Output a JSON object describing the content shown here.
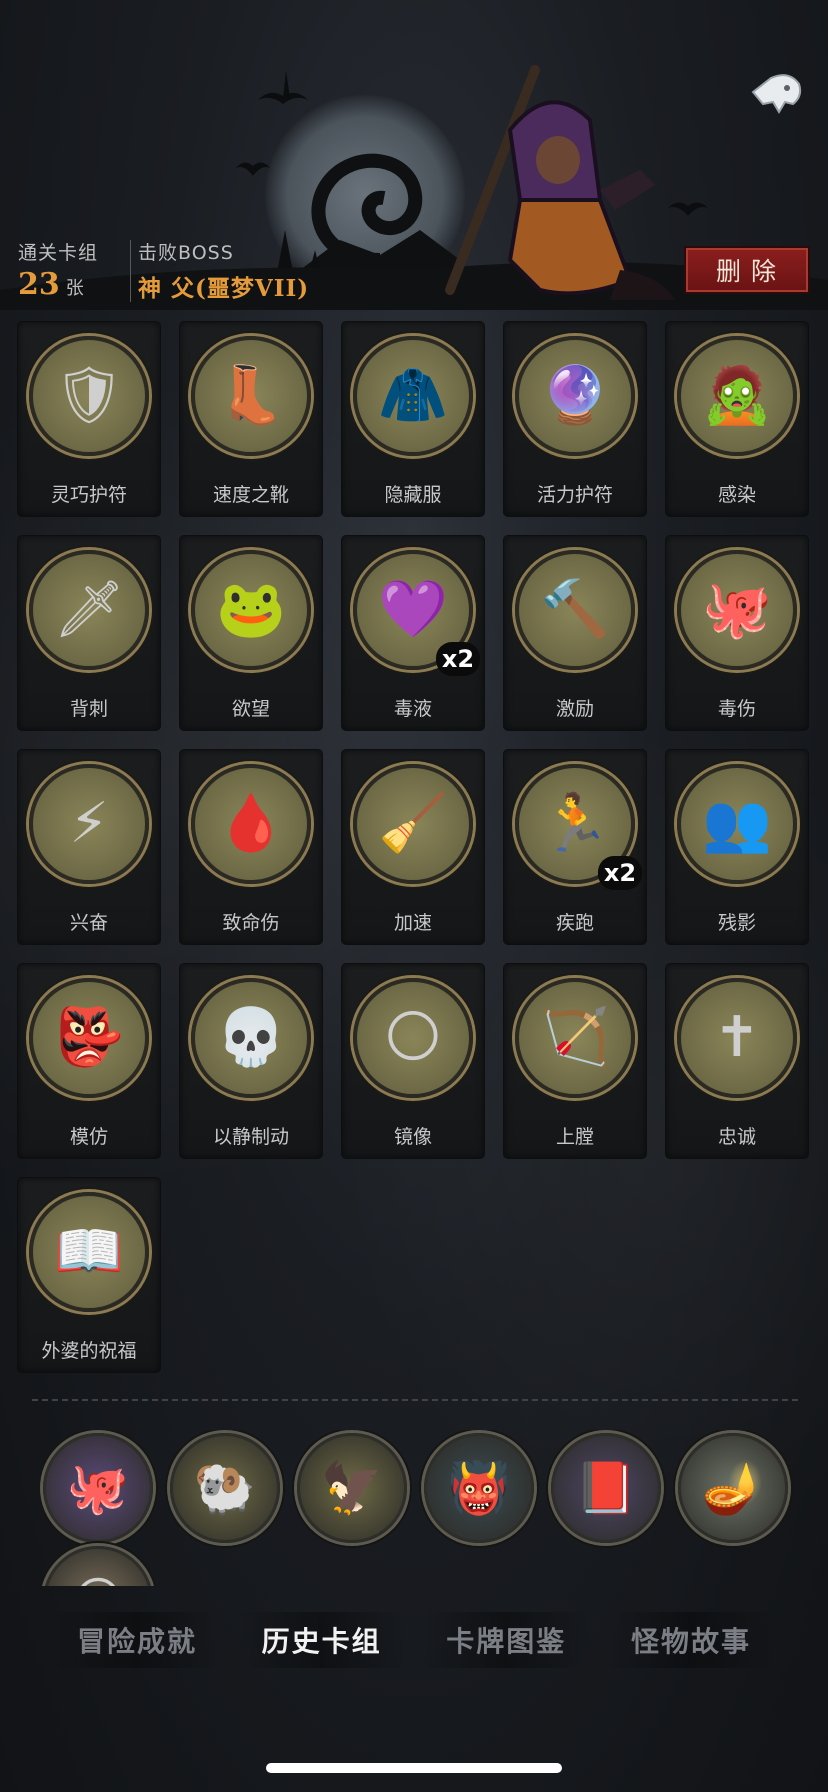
{
  "header": {
    "clear_deck_label": "通关卡组",
    "card_count": "23",
    "card_unit": "张",
    "boss_label": "击败BOSS",
    "boss_name": "神 父(噩梦VII)",
    "delete_label": "删除"
  },
  "cards": [
    {
      "name": "灵巧护符",
      "icon": "amulet-icon",
      "glyph": "🛡"
    },
    {
      "name": "速度之靴",
      "icon": "boot-icon",
      "glyph": "👢"
    },
    {
      "name": "隐藏服",
      "icon": "cloak-icon",
      "glyph": "🧥"
    },
    {
      "name": "活力护符",
      "icon": "amulet-icon",
      "glyph": "🔮"
    },
    {
      "name": "感染",
      "icon": "zombie-icon",
      "glyph": "🧟"
    },
    {
      "name": "背刺",
      "icon": "backstab-icon",
      "glyph": "🗡"
    },
    {
      "name": "欲望",
      "icon": "toad-icon",
      "glyph": "🐸"
    },
    {
      "name": "毒液",
      "icon": "poison-icon",
      "glyph": "💜",
      "badge": "x2"
    },
    {
      "name": "激励",
      "icon": "hammer-icon",
      "glyph": "🔨"
    },
    {
      "name": "毒伤",
      "icon": "tentacle-icon",
      "glyph": "🐙"
    },
    {
      "name": "兴奋",
      "icon": "excited-icon",
      "glyph": "⚡"
    },
    {
      "name": "致命伤",
      "icon": "dagger-icon",
      "glyph": "🩸"
    },
    {
      "name": "加速",
      "icon": "witch-icon",
      "glyph": "🧹"
    },
    {
      "name": "疾跑",
      "icon": "runner-icon",
      "glyph": "🏃",
      "badge": "x2"
    },
    {
      "name": "残影",
      "icon": "shadow-icon",
      "glyph": "👥"
    },
    {
      "name": "模仿",
      "icon": "goblin-icon",
      "glyph": "👺"
    },
    {
      "name": "以静制动",
      "icon": "skull-icon",
      "glyph": "💀"
    },
    {
      "name": "镜像",
      "icon": "mirror-icon",
      "glyph": "🌕"
    },
    {
      "name": "上膛",
      "icon": "crossbow-icon",
      "glyph": "🏹"
    },
    {
      "name": "忠诚",
      "icon": "cross-icon",
      "glyph": "✝"
    },
    {
      "name": "外婆的祝福",
      "icon": "grandma-icon",
      "glyph": "📖"
    }
  ],
  "relics": [
    {
      "icon": "octopus-relic-icon",
      "glyph": "🐙",
      "color": "#5b4a7a"
    },
    {
      "icon": "ram-skull-relic-icon",
      "glyph": "🐏",
      "color": "#6f6b47"
    },
    {
      "icon": "eagle-relic-icon",
      "glyph": "🦅",
      "color": "#6f6b47"
    },
    {
      "icon": "goblin-relic-icon",
      "glyph": "👹",
      "color": "#3d4a4f"
    },
    {
      "icon": "book-relic-icon",
      "glyph": "📕",
      "color": "#4e4766"
    },
    {
      "icon": "lamp-relic-icon",
      "glyph": "🪔",
      "color": "#6e7468"
    },
    {
      "icon": "face-relic-icon",
      "glyph": "😆",
      "color": "#7a6e5a"
    }
  ],
  "tabs": [
    {
      "label": "冒险成就",
      "active": false
    },
    {
      "label": "历史卡组",
      "active": true
    },
    {
      "label": "卡牌图鉴",
      "active": false
    },
    {
      "label": "怪物故事",
      "active": false
    }
  ],
  "colors": {
    "accent_orange": "#e59b3a",
    "delete_red": "#8b1e1e",
    "card_bg": "#1b1d1f"
  }
}
